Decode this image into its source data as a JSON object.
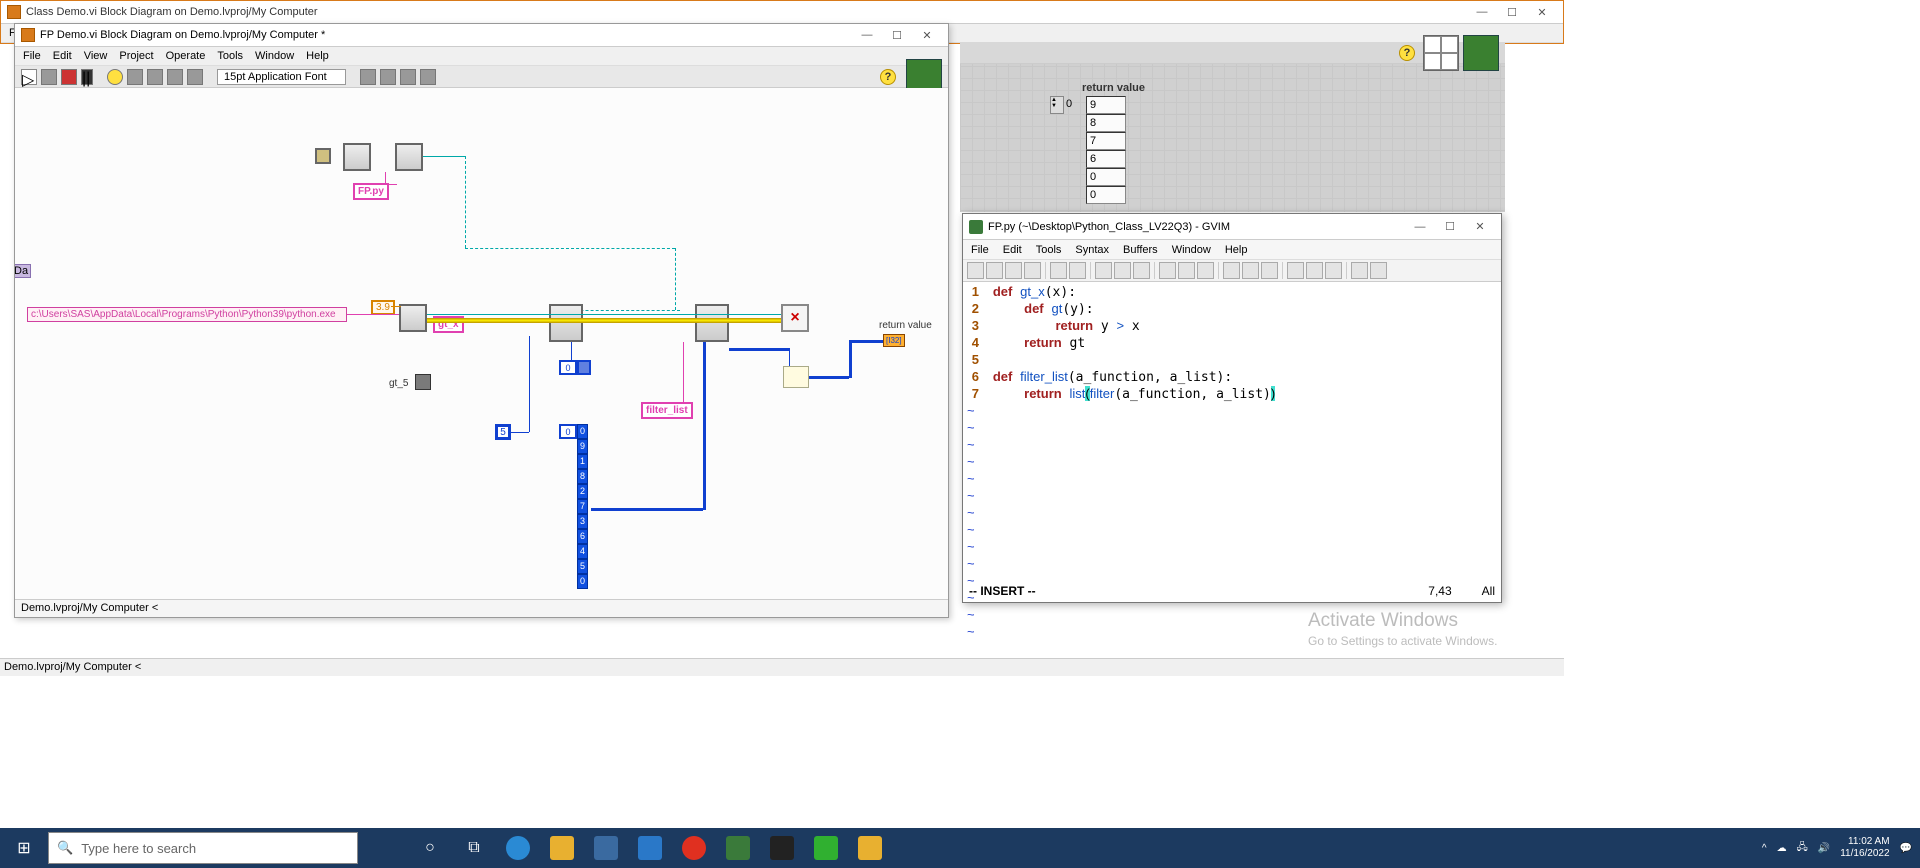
{
  "back_window": {
    "title": "Class Demo.vi Block Diagram on Demo.lvproj/My Computer",
    "status": "Demo.lvproj/My Computer  <"
  },
  "fp_panel": {
    "return_label": "return value",
    "spinner_val": "0",
    "values": [
      "9",
      "8",
      "7",
      "6",
      "0",
      "0"
    ]
  },
  "bd_window": {
    "title": "FP Demo.vi Block Diagram on Demo.lvproj/My Computer *",
    "menu": [
      "File",
      "Edit",
      "View",
      "Project",
      "Operate",
      "Tools",
      "Window",
      "Help"
    ],
    "font": "15pt Application Font",
    "status": "Demo.lvproj/My Computer  <",
    "python_path": "c:\\Users\\SAS\\AppData\\Local\\Programs\\Python\\Python39\\python.exe",
    "version": "3.9",
    "fp_py": "FP.py",
    "gt_x": "gt_x",
    "gt5": "gt_5",
    "filter_list": "filter_list",
    "five": "5",
    "arr_idx": "0",
    "arr_items": [
      "0",
      "9",
      "1",
      "8",
      "2",
      "7",
      "3",
      "6",
      "4",
      "5",
      "0"
    ],
    "arr2_idx": "0",
    "return_label": "return value",
    "return_type": "[I32]",
    "da_crumb": "Da"
  },
  "gvim": {
    "title": "FP.py (~\\Desktop\\Python_Class_LV22Q3) - GVIM",
    "menu": [
      "File",
      "Edit",
      "Tools",
      "Syntax",
      "Buffers",
      "Window",
      "Help"
    ],
    "mode": "-- INSERT --",
    "pos": "7,43",
    "pct": "All"
  },
  "watermark": {
    "line1": "Activate Windows",
    "line2": "Go to Settings to activate Windows."
  },
  "taskbar": {
    "search_placeholder": "Type here to search",
    "time": "11:02 AM",
    "date": "11/16/2022"
  },
  "da_clip": "Da"
}
